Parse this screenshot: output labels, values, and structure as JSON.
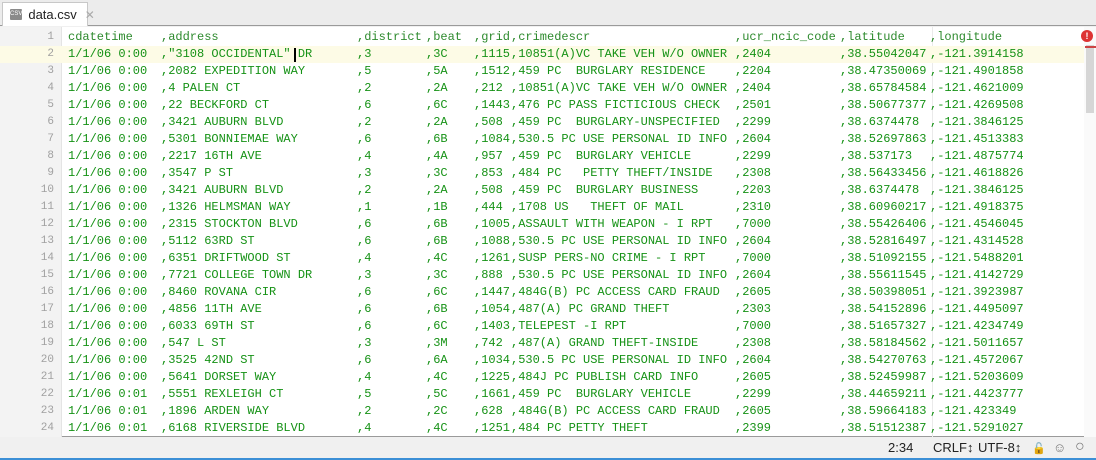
{
  "tab": {
    "title": "data.csv",
    "icon": "csv-file-icon"
  },
  "header": [
    "cdatetime",
    "address",
    "district",
    "beat",
    "grid",
    "crimedescr",
    "ucr_ncic_code",
    "latitude",
    "longitude"
  ],
  "rows": [
    [
      "1/1/06 0:00",
      "\"3108 OCCIDENTAL\" DR",
      "3",
      "3C",
      "1115",
      "10851(A)VC TAKE VEH W/O OWNER",
      "2404",
      "38.55042047",
      "-121.3914158"
    ],
    [
      "1/1/06 0:00",
      "2082 EXPEDITION WAY",
      "5",
      "5A",
      "1512",
      "459 PC  BURGLARY RESIDENCE",
      "2204",
      "38.47350069",
      "-121.4901858"
    ],
    [
      "1/1/06 0:00",
      "4 PALEN CT",
      "2",
      "2A",
      "212",
      "10851(A)VC TAKE VEH W/O OWNER",
      "2404",
      "38.65784584",
      "-121.4621009"
    ],
    [
      "1/1/06 0:00",
      "22 BECKFORD CT",
      "6",
      "6C",
      "1443",
      "476 PC PASS FICTICIOUS CHECK",
      "2501",
      "38.50677377",
      "-121.4269508"
    ],
    [
      "1/1/06 0:00",
      "3421 AUBURN BLVD",
      "2",
      "2A",
      "508",
      "459 PC  BURGLARY-UNSPECIFIED",
      "2299",
      "38.6374478",
      "-121.3846125"
    ],
    [
      "1/1/06 0:00",
      "5301 BONNIEMAE WAY",
      "6",
      "6B",
      "1084",
      "530.5 PC USE PERSONAL ID INFO",
      "2604",
      "38.52697863",
      "-121.4513383"
    ],
    [
      "1/1/06 0:00",
      "2217 16TH AVE",
      "4",
      "4A",
      "957",
      "459 PC  BURGLARY VEHICLE",
      "2299",
      "38.537173",
      "-121.4875774"
    ],
    [
      "1/1/06 0:00",
      "3547 P ST",
      "3",
      "3C",
      "853",
      "484 PC   PETTY THEFT/INSIDE",
      "2308",
      "38.56433456",
      "-121.4618826"
    ],
    [
      "1/1/06 0:00",
      "3421 AUBURN BLVD",
      "2",
      "2A",
      "508",
      "459 PC  BURGLARY BUSINESS",
      "2203",
      "38.6374478",
      "-121.3846125"
    ],
    [
      "1/1/06 0:00",
      "1326 HELMSMAN WAY",
      "1",
      "1B",
      "444",
      "1708 US   THEFT OF MAIL",
      "2310",
      "38.60960217",
      "-121.4918375"
    ],
    [
      "1/1/06 0:00",
      "2315 STOCKTON BLVD",
      "6",
      "6B",
      "1005",
      "ASSAULT WITH WEAPON - I RPT",
      "7000",
      "38.55426406",
      "-121.4546045"
    ],
    [
      "1/1/06 0:00",
      "5112 63RD ST",
      "6",
      "6B",
      "1088",
      "530.5 PC USE PERSONAL ID INFO",
      "2604",
      "38.52816497",
      "-121.4314528"
    ],
    [
      "1/1/06 0:00",
      "6351 DRIFTWOOD ST",
      "4",
      "4C",
      "1261",
      "SUSP PERS-NO CRIME - I RPT",
      "7000",
      "38.51092155",
      "-121.5488201"
    ],
    [
      "1/1/06 0:00",
      "7721 COLLEGE TOWN DR",
      "3",
      "3C",
      "888",
      "530.5 PC USE PERSONAL ID INFO",
      "2604",
      "38.55611545",
      "-121.4142729"
    ],
    [
      "1/1/06 0:00",
      "8460 ROVANA CIR",
      "6",
      "6C",
      "1447",
      "484G(B) PC ACCESS CARD FRAUD",
      "2605",
      "38.50398051",
      "-121.3923987"
    ],
    [
      "1/1/06 0:00",
      "4856 11TH AVE",
      "6",
      "6B",
      "1054",
      "487(A) PC GRAND THEFT",
      "2303",
      "38.54152896",
      "-121.4495097"
    ],
    [
      "1/1/06 0:00",
      "6033 69TH ST",
      "6",
      "6C",
      "1403",
      "TELEPEST -I RPT",
      "7000",
      "38.51657327",
      "-121.4234749"
    ],
    [
      "1/1/06 0:00",
      "547 L ST",
      "3",
      "3M",
      "742",
      "487(A) GRAND THEFT-INSIDE",
      "2308",
      "38.58184562",
      "-121.5011657"
    ],
    [
      "1/1/06 0:00",
      "3525 42ND ST",
      "6",
      "6A",
      "1034",
      "530.5 PC USE PERSONAL ID INFO",
      "2604",
      "38.54270763",
      "-121.4572067"
    ],
    [
      "1/1/06 0:00",
      "5641 DORSET WAY",
      "4",
      "4C",
      "1225",
      "484J PC PUBLISH CARD INFO",
      "2605",
      "38.52459987",
      "-121.5203609"
    ],
    [
      "1/1/06 0:01",
      "5551 REXLEIGH CT",
      "5",
      "5C",
      "1661",
      "459 PC  BURGLARY VEHICLE",
      "2299",
      "38.44659211",
      "-121.4423777"
    ],
    [
      "1/1/06 0:01",
      "1896 ARDEN WAY",
      "2",
      "2C",
      "628",
      "484G(B) PC ACCESS CARD FRAUD",
      "2605",
      "38.59664183",
      "-121.423349"
    ],
    [
      "1/1/06 0:01",
      "6168 RIVERSIDE BLVD",
      "4",
      "4C",
      "1251",
      "484 PC PETTY THEFT",
      "2399",
      "38.51512387",
      "-121.5291027"
    ]
  ],
  "status": {
    "position": "2:34",
    "line_ending": "CRLF↕",
    "encoding": "UTF-8↕"
  },
  "colors": {
    "data_text": "#169216",
    "current_line": "#fdfbe6",
    "error": "#d33333",
    "status_border": "#3c8fd6"
  }
}
